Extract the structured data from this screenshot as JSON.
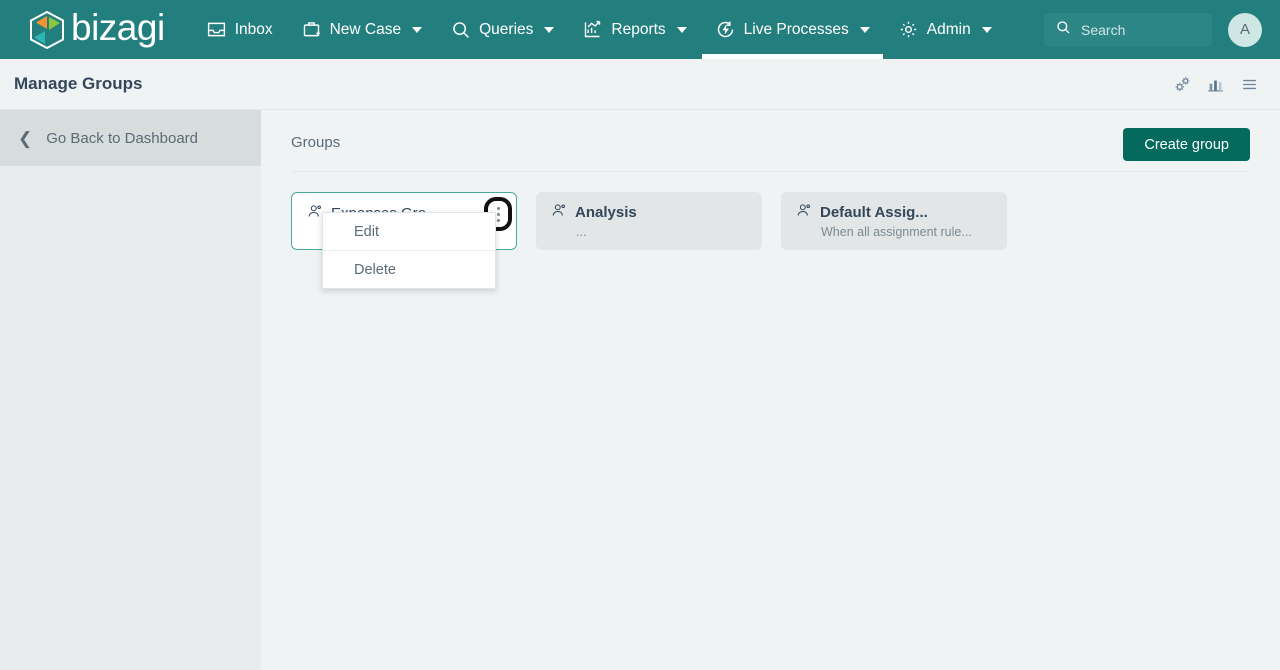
{
  "brand": {
    "name": "bizagi",
    "logo_icon": "bizagi-hexagon-logo"
  },
  "topnav": {
    "items": [
      {
        "label": "Inbox",
        "icon": "inbox-icon",
        "caret": false,
        "active": false
      },
      {
        "label": "New Case",
        "icon": "briefcase-plus-icon",
        "caret": true,
        "active": false
      },
      {
        "label": "Queries",
        "icon": "search-icon",
        "caret": true,
        "active": false
      },
      {
        "label": "Reports",
        "icon": "chart-line-icon",
        "caret": true,
        "active": false
      },
      {
        "label": "Live Processes",
        "icon": "bolt-circle-icon",
        "caret": true,
        "active": true
      },
      {
        "label": "Admin",
        "icon": "gear-icon",
        "caret": true,
        "active": false
      }
    ],
    "search": {
      "placeholder": "Search",
      "value": "",
      "icon": "search-icon"
    },
    "avatar": {
      "initial": "A"
    }
  },
  "page_header": {
    "title": "Manage Groups",
    "actions": [
      {
        "icon": "gears-link-icon"
      },
      {
        "icon": "bar-chart-icon"
      },
      {
        "icon": "hamburger-menu-icon"
      }
    ]
  },
  "sidebar": {
    "back": {
      "label": "Go Back to Dashboard",
      "icon": "chevron-left-icon"
    }
  },
  "main": {
    "section_label": "Groups",
    "create_button": "Create group",
    "cards": [
      {
        "title": "Expenses Gro...",
        "subtitle": "",
        "icon": "user-group-icon",
        "selected": true,
        "menu_open": true
      },
      {
        "title": "Analysis",
        "subtitle": "...",
        "icon": "user-group-icon",
        "selected": false,
        "menu_open": false
      },
      {
        "title": "Default Assig...",
        "subtitle": "When all assignment rule...",
        "icon": "user-group-icon",
        "selected": false,
        "menu_open": false
      }
    ],
    "context_menu": {
      "items": [
        {
          "label": "Edit"
        },
        {
          "label": "Delete"
        }
      ]
    }
  },
  "colors": {
    "nav_teal": "#237e7e",
    "search_teal": "#2c8686",
    "page_bg": "#eff3f3",
    "sidebar_bg": "#e9ecec",
    "back_row_bg": "#d7dcdd",
    "card_bg": "#e3e6e6",
    "card_selected_border": "#49a99c",
    "create_button_bg": "#046a5d",
    "title_text": "#33475b",
    "muted_text": "#5b6b77"
  }
}
